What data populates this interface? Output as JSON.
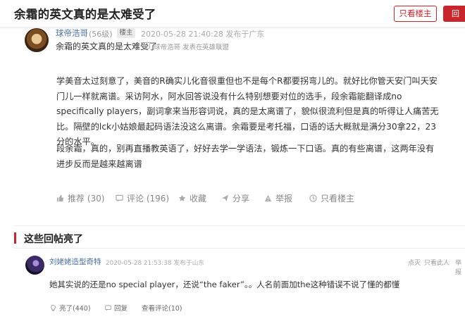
{
  "header": {
    "title": "余霜的英文真的是太难受了",
    "only_op_button": "只看楼主",
    "right_button": "回"
  },
  "post": {
    "author": "球帝浩哥",
    "level": "(56级)",
    "op_badge": "楼主",
    "meta": "2020-05-28 21:40:28 发布于广东",
    "title": "余霜的英文真的是太难受了",
    "sub_meta": "球帝浩哥 发表在",
    "board": "英雄联盟",
    "paragraphs": [
      "学美音太过刻意了，美音的R确实儿化音很重但也不是每个R都要拐弯儿的。就好比你管天安门叫天安门儿一样就离谱。采访阿水，阿水回答说没有什么特别想要对位的选手，段余霜能翻译成no specifically players，副词拿来当形容词说，真的是太离谱了，貌似很流利但是真的听得让人痛苦无比。隔壁的lck小姑娘最起码语法没这么离谱。余霜要是考托福，口语的话大概就是满分30拿22，23分的水平。",
      "段余霜，真的，别再直播教英语了，好好去学一学语法，锻炼一下口语。真的有些离谱，这两年没有进步反而是越来越离谱"
    ],
    "actions": {
      "recommend": "推荐 (30)",
      "comment": "评论 (196)",
      "favorite": "收藏",
      "share": "分享",
      "report": "举报",
      "only_op": "只看楼主"
    }
  },
  "hot_replies": {
    "section_title": "这些回帖亮了",
    "items": [
      {
        "author": "刘姥姥造型奇特",
        "meta": "2020-05-28 21:53:38 发布于山东",
        "right_actions": [
          "点灭",
          "只看此人",
          "举报"
        ],
        "text": "她其实说的还是no special player，还说“the faker”。。人名前面加the这种错误不说了懂的都懂",
        "actions": {
          "light": "亮了(440)",
          "reply": "回复",
          "view_replies": "查看评论(10)"
        }
      }
    ]
  },
  "colors": {
    "accent": "#c9252d",
    "link": "#4a6fa5",
    "muted": "#999999"
  }
}
